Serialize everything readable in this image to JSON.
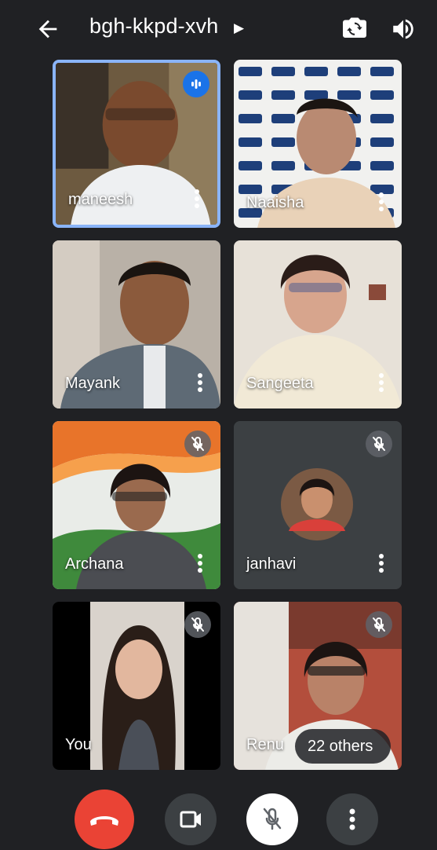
{
  "header": {
    "meeting_code": "bgh-kkpd-xvh",
    "icons": [
      "arrow-back-icon",
      "caret-right-icon",
      "switch-camera-icon",
      "speaker-icon"
    ]
  },
  "participants": [
    {
      "name": "maneesh",
      "muted": false,
      "speaking": true
    },
    {
      "name": "Naaisha",
      "muted": false,
      "speaking": false
    },
    {
      "name": "Mayank",
      "muted": false,
      "speaking": false
    },
    {
      "name": "Sangeeta",
      "muted": false,
      "speaking": false
    },
    {
      "name": "Archana",
      "muted": true,
      "speaking": false
    },
    {
      "name": "janhavi",
      "muted": true,
      "speaking": false
    },
    {
      "name": "You",
      "muted": true,
      "speaking": false
    },
    {
      "name": "Renu",
      "muted": true,
      "speaking": false
    }
  ],
  "others_label": "22 others",
  "controls": {
    "end_call": "end-call-icon",
    "camera": "videocam-icon",
    "mic": "mic-off-icon",
    "more": "more-vert-icon"
  },
  "colors": {
    "background": "#202124",
    "tile": "#3c4043",
    "active_border": "#8ab4f8",
    "end_call": "#ea4335",
    "speaking": "#1a73e8"
  }
}
